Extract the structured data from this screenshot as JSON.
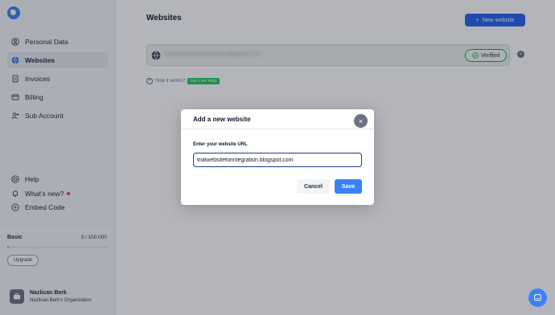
{
  "sidebar": {
    "nav": [
      {
        "label": "Personal Data",
        "icon": "user-icon"
      },
      {
        "label": "Websites",
        "icon": "globe-icon",
        "active": true
      },
      {
        "label": "Invoices",
        "icon": "document-icon"
      },
      {
        "label": "Billing",
        "icon": "billing-icon"
      },
      {
        "label": "Sub Account",
        "icon": "user-plus-icon"
      }
    ],
    "bottom_nav": [
      {
        "label": "Help",
        "icon": "help-icon"
      },
      {
        "label": "What's new?",
        "icon": "bell-icon"
      },
      {
        "label": "Embed Code",
        "icon": "embed-icon"
      }
    ],
    "plan": {
      "name": "Basic",
      "count": "3 / 100.000",
      "usage_fraction": 3e-05,
      "upgrade_label": "Upgrade"
    },
    "user": {
      "name": "Nazlican Berk",
      "org": "Nazlican Berk's Organization"
    }
  },
  "main": {
    "title": "Websites",
    "new_website_label": "New website",
    "website_row": {
      "url": "trialwebsiteforintegration.blogspot.com",
      "status": "Verified"
    },
    "help_line": {
      "text": "How it works?",
      "live_help": "Get Live Help"
    }
  },
  "modal": {
    "title": "Add a new website",
    "field_label": "Enter your website URL",
    "field_value": "trialwebsiteforintegration.blogspot.com",
    "cancel_label": "Cancel",
    "save_label": "Save"
  },
  "colors": {
    "accent": "#3b82f6",
    "verified": "#16a34a",
    "live_help": "#22c55e"
  }
}
